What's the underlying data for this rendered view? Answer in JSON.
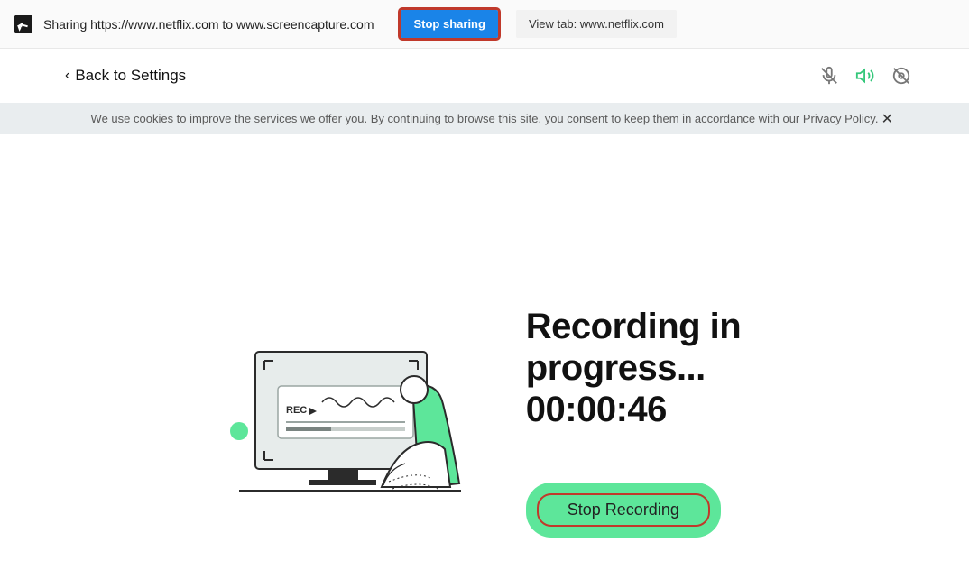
{
  "share_bar": {
    "text": "Sharing https://www.netflix.com to www.screencapture.com",
    "stop_label": "Stop sharing",
    "view_tab_label": "View tab: www.netflix.com"
  },
  "header": {
    "back_label": "Back to Settings"
  },
  "cookie": {
    "text_before": "We use cookies to improve the services we offer you. By continuing to browse this site, you consent to keep them in accordance with our ",
    "link_label": "Privacy Policy",
    "text_after": "."
  },
  "recording": {
    "heading_line1": "Recording in",
    "heading_line2": "progress...",
    "timer": "00:00:46",
    "stop_label": "Stop Recording"
  }
}
